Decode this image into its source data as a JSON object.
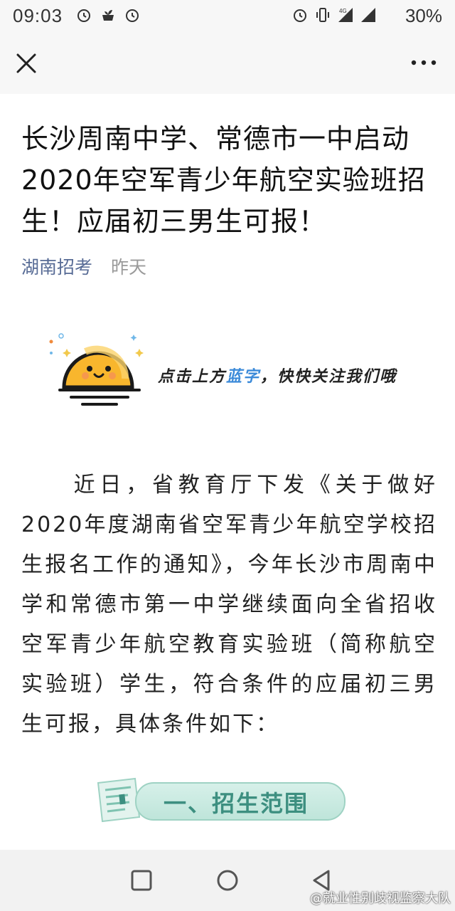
{
  "status_bar": {
    "time": "09:03",
    "left_icons": [
      "alarm-icon",
      "plant-icon",
      "alarm-icon"
    ],
    "right_icons": [
      "alarm-icon",
      "vibrate-icon",
      "signal-4g-icon",
      "signal-icon"
    ],
    "battery": "30%"
  },
  "toolbar": {
    "close_icon": "close-icon",
    "more_icon": "more-icon"
  },
  "article": {
    "title": "长沙周南中学、常德市一中启动2020年空军青少年航空实验班招生！应届初三男生可报！",
    "account": "湖南招考",
    "date": "昨天",
    "follow_banner": {
      "text_before": "点击上方",
      "text_blue": "蓝字",
      "text_after": "，快快关注我们哦",
      "colors": {
        "blue": "#3b8ad9"
      }
    },
    "paragraph": "　　近日，省教育厅下发《关于做好2020年度湖南省空军青少年航空学校招生报名工作的通知》，今年长沙市周南中学和常德市第一中学继续面向全省招收空军青少年航空教育实验班（简称航空实验班）学生，符合条件的应届初三男生可报，具体条件如下：",
    "section_heading": "一、招生范围"
  },
  "nav_bar": {
    "buttons": [
      "recents-square-icon",
      "home-circle-icon",
      "back-triangle-icon"
    ]
  },
  "watermark": "@就业性别歧视监察大队",
  "colors": {
    "account_link": "#576b95",
    "section_green": "#3d8f80"
  }
}
